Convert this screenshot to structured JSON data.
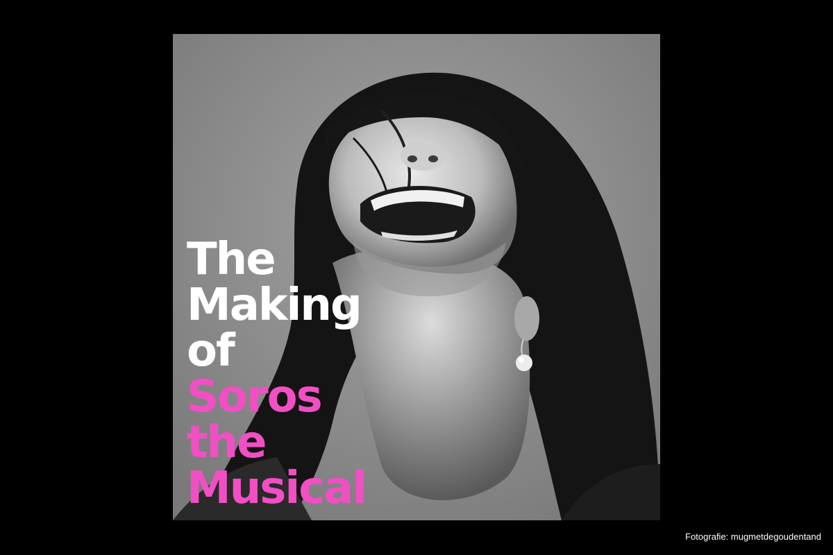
{
  "poster": {
    "title_lines": [
      {
        "text": "The",
        "color": "#ffffff"
      },
      {
        "text": "Making",
        "color": "#ffffff"
      },
      {
        "text": "of",
        "color": "#ffffff"
      },
      {
        "text": "Soros",
        "color": "#f24fc4"
      },
      {
        "text": "the",
        "color": "#f24fc4"
      },
      {
        "text": "Musical",
        "color": "#f24fc4"
      }
    ],
    "photo_subject": "black-and-white portrait of a laughing woman with dark hair and pearl earring"
  },
  "credit": {
    "text": "Fotografie: mugmetdegoudentand"
  },
  "colors": {
    "background": "#000000",
    "accent_pink": "#f24fc4",
    "title_white": "#ffffff"
  }
}
